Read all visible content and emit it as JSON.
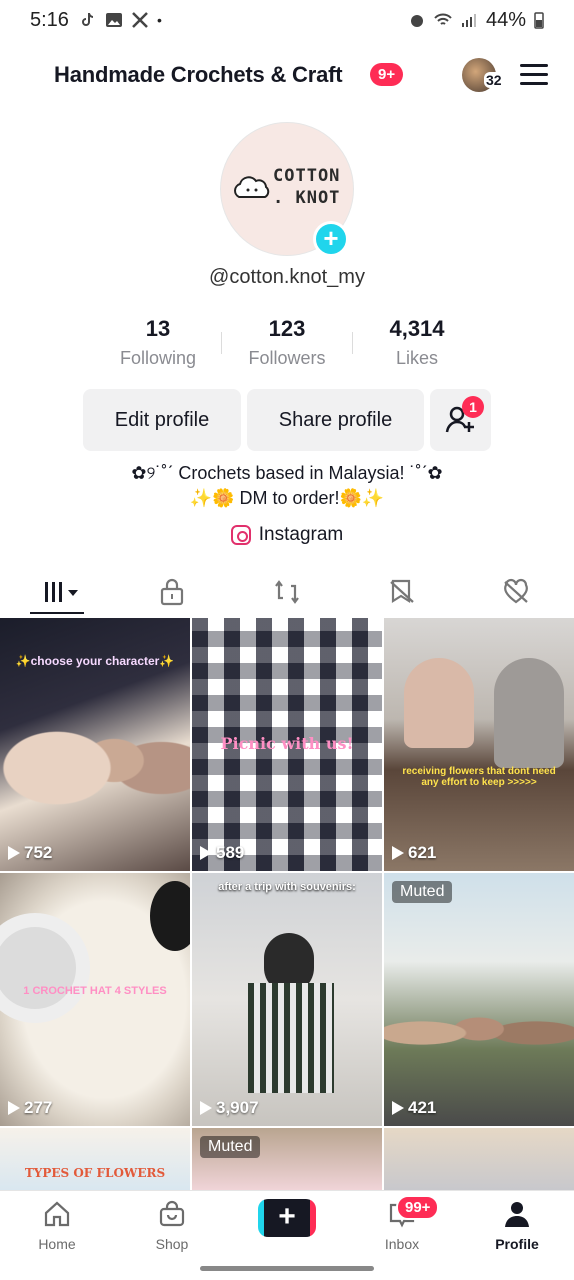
{
  "status_bar": {
    "time": "5:16",
    "battery": "44%"
  },
  "header": {
    "title": "Handmade Crochets & Craft",
    "notif_badge": "9+",
    "account_count": "32"
  },
  "profile": {
    "logo_line1": "COTTON",
    "logo_line2": ". KNOT",
    "handle": "@cotton.knot_my",
    "stats": [
      {
        "value": "13",
        "label": "Following"
      },
      {
        "value": "123",
        "label": "Followers"
      },
      {
        "value": "4,314",
        "label": "Likes"
      }
    ],
    "edit_label": "Edit profile",
    "share_label": "Share profile",
    "friend_requests": "1",
    "bio_line1": "✿୨˙˚ˊ Crochets based in Malaysia! ˙˚ˊ✿",
    "bio_line2": "✨🌼 DM to order!🌼✨",
    "link_label": "Instagram"
  },
  "videos": [
    {
      "views": "752",
      "caption": "✨choose your character✨",
      "muted": ""
    },
    {
      "views": "589",
      "caption": "Picnic with us!",
      "muted": ""
    },
    {
      "views": "621",
      "caption": "receiving flowers that dont need any effort to keep >>>>>",
      "muted": ""
    },
    {
      "views": "277",
      "caption": "1 CROCHET HAT 4 STYLES",
      "muted": ""
    },
    {
      "views": "3,907",
      "caption": "after a trip with souvenirs:",
      "muted": ""
    },
    {
      "views": "421",
      "caption": "",
      "muted": "Muted"
    },
    {
      "views": "",
      "caption": "TYPES OF FLOWERS",
      "muted": ""
    },
    {
      "views": "",
      "caption": "",
      "muted": "Muted"
    }
  ],
  "nav": {
    "home": "Home",
    "shop": "Shop",
    "inbox": "Inbox",
    "inbox_badge": "99+",
    "profile": "Profile"
  }
}
